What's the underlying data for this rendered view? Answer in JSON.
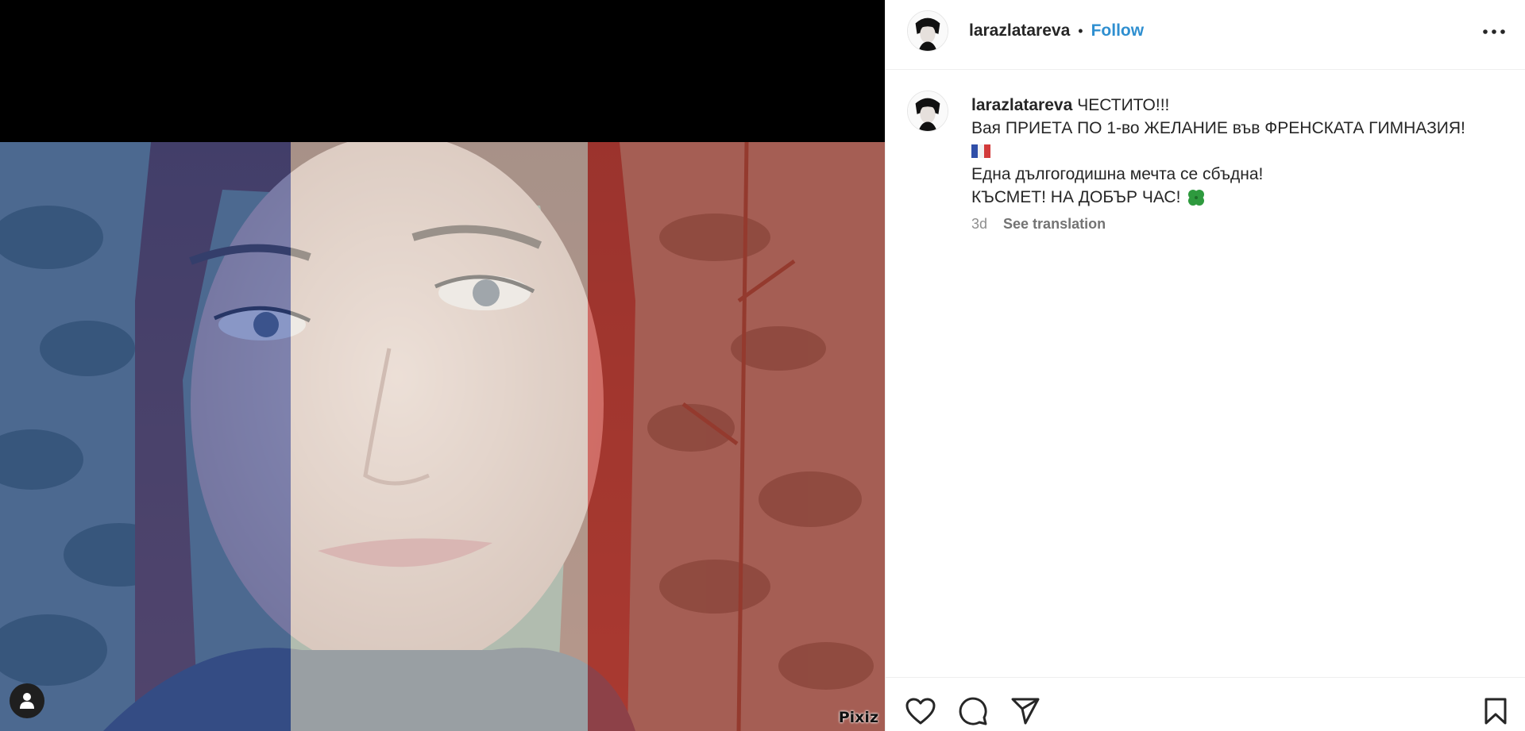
{
  "media": {
    "watermark": "Pixiz"
  },
  "header": {
    "username": "larazlatareva",
    "separator": "•",
    "follow_label": "Follow"
  },
  "caption": {
    "username": "larazlatareva",
    "line1": "ЧЕСТИТО!!!",
    "line2": "Вая ПРИЕТА ПО 1-во ЖЕЛАНИЕ във ФРЕНСКАТА ГИМНАЗИЯ!",
    "line3": "Една дългогодишна мечта се сбъдна!",
    "line4": "КЪСМЕТ! НА ДОБЪР ЧАС!",
    "time_ago": "3d",
    "see_translation": "See translation"
  },
  "icons": {
    "more": "more-options-icon",
    "like": "heart-icon",
    "comment": "comment-icon",
    "share": "share-icon",
    "save": "bookmark-icon",
    "tag": "user-tag-icon"
  },
  "colors": {
    "flag_blue": "#2f4ea8",
    "flag_white": "#e8e6e0",
    "flag_red": "#d23a3a",
    "link": "#2f8fd0"
  }
}
